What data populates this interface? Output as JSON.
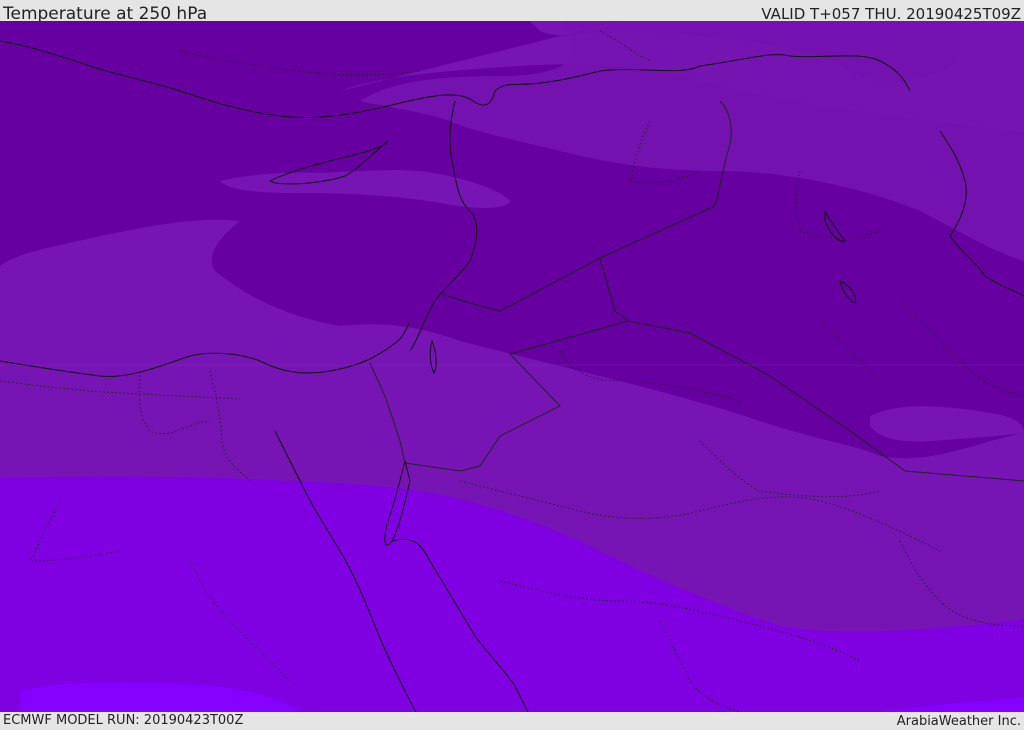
{
  "header": {
    "title": "Temperature at 250 hPa",
    "valid": "VALID T+057 THU. 20190425T09Z"
  },
  "footer": {
    "model_run": "ECMWF MODEL RUN: 20190423T00Z",
    "credit": "ArabiaWeather Inc."
  },
  "colors": {
    "band_coldest": "#6600a0",
    "band_cold": "#7714b4",
    "band_mid": "#7a10c8",
    "band_warm": "#7f00e0",
    "band_warmest": "#8000ff",
    "coastline": "#111111",
    "border": "#222222",
    "background": "#e5e5e5"
  }
}
